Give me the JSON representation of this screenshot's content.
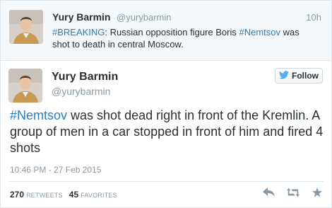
{
  "top_tweet": {
    "name": "Yury Barmin",
    "handle": "@yurybarmin",
    "time": "10h",
    "text_parts": {
      "hashtag1": "#BREAKING",
      "mid": ": Russian opposition figure Boris ",
      "hashtag2": "#Nemtsov",
      "tail": " was shot to death in central Moscow."
    }
  },
  "main_tweet": {
    "name": "Yury Barmin",
    "handle": "@yurybarmin",
    "follow_label": "Follow",
    "hashtag": "#Nemtsov",
    "text": " was shot dead right in front of the Kremlin. A group of men in a car stopped in front of him and fired 4 shots",
    "date": "10:46 PM - 27 Feb 2015",
    "retweets_count": "270",
    "retweets_label": "Retweets",
    "favorites_count": "45",
    "favorites_label": "Favorites"
  },
  "icons": {
    "follow": "twitter-bird-icon",
    "reply": "reply-icon",
    "retweet": "retweet-icon",
    "favorite": "star-icon"
  },
  "colors": {
    "link": "#2b7bb9",
    "muted": "#8899a6",
    "text": "#292f33",
    "follow_bird": "#55acee"
  }
}
